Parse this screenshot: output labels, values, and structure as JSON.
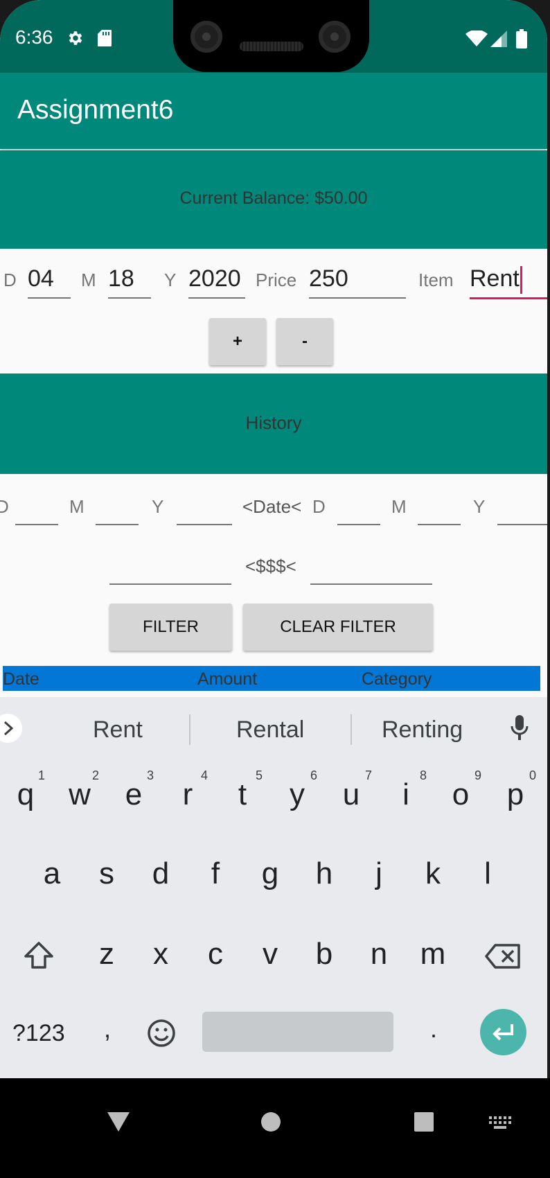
{
  "status_bar": {
    "time": "6:36"
  },
  "app_bar": {
    "title": "Assignment6"
  },
  "balance": {
    "text": "Current Balance: $50.00"
  },
  "entry": {
    "day_label": "D",
    "day_value": "04",
    "month_label": "M",
    "month_value": "18",
    "year_label": "Y",
    "year_value": "2020",
    "price_label": "Price",
    "price_value": "250",
    "item_label": "Item",
    "item_value": "Rent",
    "add_label": "+",
    "subtract_label": "-"
  },
  "history": {
    "title": "History"
  },
  "filter": {
    "from_day_label": "D",
    "from_month_label": "M",
    "from_year_label": "Y",
    "date_sep": "<Date<",
    "to_day_label": "D",
    "to_month_label": "M",
    "to_year_label": "Y",
    "amount_sep": "<$$$<",
    "filter_label": "FILTER",
    "clear_label": "CLEAR FILTER"
  },
  "table": {
    "columns": [
      "Date",
      "Amount",
      "Category"
    ]
  },
  "keyboard": {
    "suggestions": [
      "Rent",
      "Rental",
      "Renting"
    ],
    "row1": [
      "q",
      "w",
      "e",
      "r",
      "t",
      "y",
      "u",
      "i",
      "o",
      "p"
    ],
    "row1_hints": [
      "1",
      "2",
      "3",
      "4",
      "5",
      "6",
      "7",
      "8",
      "9",
      "0"
    ],
    "row2": [
      "a",
      "s",
      "d",
      "f",
      "g",
      "h",
      "j",
      "k",
      "l"
    ],
    "row3": [
      "z",
      "x",
      "c",
      "v",
      "b",
      "n",
      "m"
    ],
    "symbols_label": "?123",
    "comma": ",",
    "period": "."
  },
  "colors": {
    "primary": "#00897b",
    "primary_dark": "#00695c",
    "accent": "#d81b60",
    "table_header": "#0277d6"
  }
}
